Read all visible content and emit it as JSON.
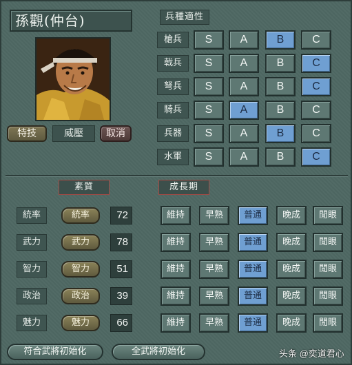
{
  "character": {
    "name": "孫觀(仲台)",
    "skill_button": "特技",
    "skill_value": "威壓",
    "cancel_button": "取消"
  },
  "aptitude": {
    "heading": "兵種適性",
    "grade_labels": [
      "S",
      "A",
      "B",
      "C"
    ],
    "rows": [
      {
        "label": "槍兵",
        "selected": "B"
      },
      {
        "label": "戟兵",
        "selected": "C"
      },
      {
        "label": "弩兵",
        "selected": "C"
      },
      {
        "label": "騎兵",
        "selected": "A"
      },
      {
        "label": "兵器",
        "selected": "B"
      },
      {
        "label": "水軍",
        "selected": "C"
      }
    ]
  },
  "stats": {
    "quality_heading": "素質",
    "growth_heading": "成長期",
    "growth_labels": [
      "維持",
      "早熟",
      "普通",
      "晚成",
      "閒眼"
    ],
    "rows": [
      {
        "label": "統率",
        "button": "統率",
        "value": "72",
        "growth": "普通"
      },
      {
        "label": "武力",
        "button": "武力",
        "value": "78",
        "growth": "普通"
      },
      {
        "label": "智力",
        "button": "智力",
        "value": "51",
        "growth": "普通"
      },
      {
        "label": "政治",
        "button": "政治",
        "value": "39",
        "growth": "普通"
      },
      {
        "label": "魅力",
        "button": "魅力",
        "value": "66",
        "growth": "普通"
      }
    ]
  },
  "footer": {
    "reset_matching": "符合武將初始化",
    "reset_all": "全武將初始化"
  },
  "watermark": "头条 @奕道君心"
}
